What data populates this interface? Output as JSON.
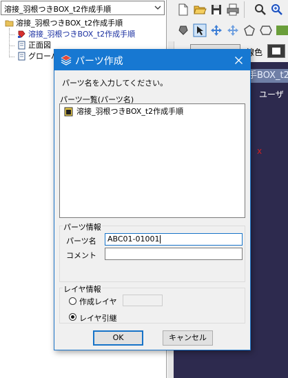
{
  "left_panel": {
    "combo_value": "溶接_羽根つきBOX_t2作成手順",
    "tree": [
      {
        "label": "溶接_羽根つきBOX_t2作成手順",
        "icon": "folder-icon",
        "selected": false
      },
      {
        "label": "溶接_羽根つきBOX_t2作成手順",
        "icon": "part-red-icon",
        "selected": true
      },
      {
        "label": "正面図",
        "icon": "view-icon",
        "selected": false
      },
      {
        "label": "グローバ",
        "icon": "view-icon",
        "selected": false
      }
    ]
  },
  "right_area": {
    "color_label": "線色",
    "viewport_tab": "手BOX_t2",
    "viewport_label": "ユーザ",
    "axis_marker": "x",
    "viewport_color": "#2d2a4e"
  },
  "dialog": {
    "title": "パーツ作成",
    "instruction": "パーツ名を入力してください。",
    "list_label": "パーツ一覧(パーツ名)",
    "list_items": [
      "溶接_羽根つきBOX_t2作成手順"
    ],
    "part_info": {
      "group_title": "パーツ情報",
      "name_label": "パーツ名",
      "name_value": "ABC01-01001",
      "comment_label": "コメント",
      "comment_value": ""
    },
    "layer_info": {
      "group_title": "レイヤ情報",
      "option_create": "作成レイヤ",
      "option_inherit": "レイヤ引継",
      "selected": "レイヤ引継"
    },
    "ok_label": "OK",
    "cancel_label": "キャンセル",
    "accent_color": "#1778d2"
  }
}
